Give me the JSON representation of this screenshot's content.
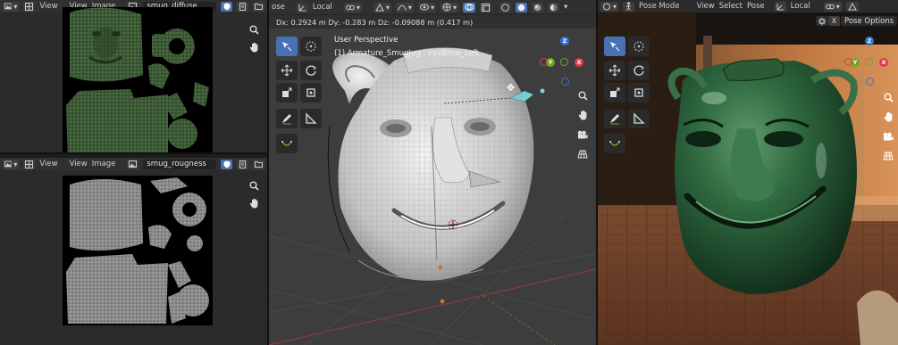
{
  "image_editor_top": {
    "view_label": "View",
    "view_menu": "View",
    "image_menu": "Image",
    "image_name": "smug_diffuse"
  },
  "image_editor_bottom": {
    "view_label": "View",
    "view_menu": "View",
    "image_menu": "Image",
    "image_name": "smug_rougness"
  },
  "viewport": {
    "mode_label": "ose",
    "orientation": "Local",
    "status_line": "Dx: 0.2924 m   Dy: -0.283 m   Dz: -0.09088 m (0.417 m)",
    "perspective": "User Perspective",
    "selection": "(1) Armature_SmugJug : eyeBrow_Left"
  },
  "render_view": {
    "mode": "Pose Mode",
    "view_menu": "View",
    "select_menu": "Select",
    "pose_menu": "Pose",
    "orientation": "Local",
    "pose_options": "Pose Options"
  },
  "gizmo": {
    "z": "Z",
    "y": "Y",
    "x": "X"
  },
  "colors": {
    "accent": "#4772b3",
    "axis_x": "#e2394a",
    "axis_y": "#6ea81f",
    "axis_z": "#2f74d6",
    "diffuse_green": "#3f5a35",
    "roughness_gray": "#8c8c8c",
    "jug_green": "#2c5a37"
  },
  "icons": [
    "image-editor-icon",
    "grid-icon",
    "search-icon",
    "hand-icon",
    "camera-icon",
    "move-icon",
    "rotate-icon",
    "scale-icon",
    "transform-icon",
    "annotate-icon",
    "measure-icon",
    "link-icon",
    "shield-icon"
  ]
}
